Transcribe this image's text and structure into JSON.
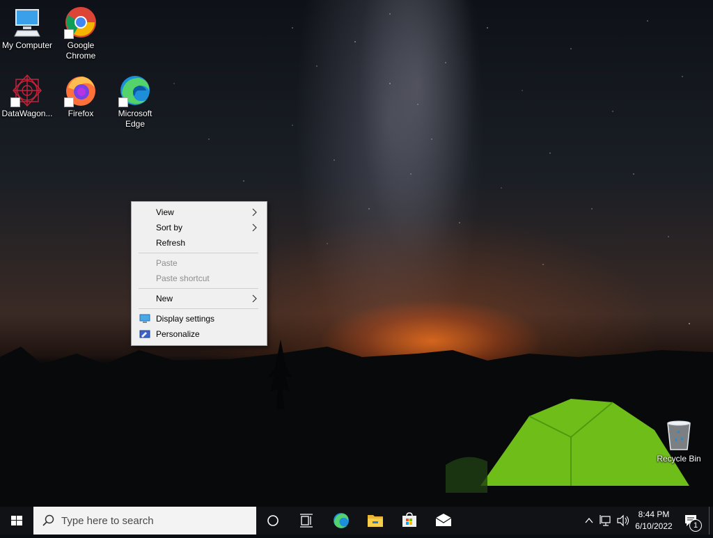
{
  "desktop": {
    "icons": [
      {
        "label": "My Computer"
      },
      {
        "label": "Google Chrome"
      },
      {
        "label": "DataWagon..."
      },
      {
        "label": "Firefox"
      },
      {
        "label": "Microsoft Edge"
      },
      {
        "label": "Recycle Bin"
      }
    ]
  },
  "context_menu": {
    "items": [
      {
        "label": "View",
        "submenu": true,
        "enabled": true
      },
      {
        "label": "Sort by",
        "submenu": true,
        "enabled": true
      },
      {
        "label": "Refresh",
        "enabled": true
      },
      {
        "label": "Paste",
        "enabled": false
      },
      {
        "label": "Paste shortcut",
        "enabled": false
      },
      {
        "label": "New",
        "submenu": true,
        "enabled": true
      },
      {
        "label": "Display settings",
        "icon": "display-icon",
        "enabled": true
      },
      {
        "label": "Personalize",
        "icon": "personalize-icon",
        "enabled": true
      }
    ]
  },
  "taskbar": {
    "search_placeholder": "Type here to search",
    "pinned": [
      "edge-icon",
      "file-explorer-icon",
      "store-icon",
      "mail-icon"
    ],
    "clock": {
      "time": "8:44 PM",
      "date": "6/10/2022"
    },
    "notifications_count": "1"
  }
}
